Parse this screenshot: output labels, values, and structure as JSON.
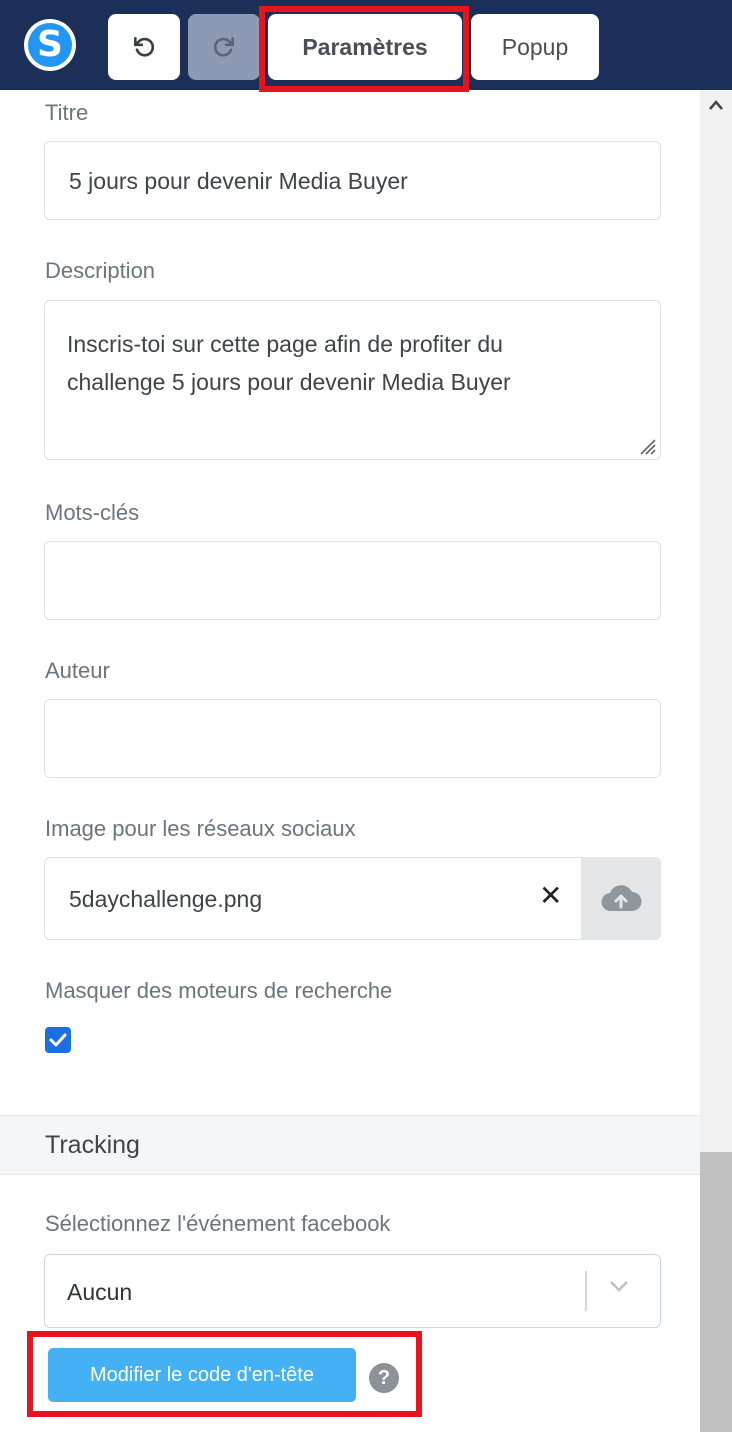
{
  "toolbar": {
    "logo_letter": "S",
    "undo_icon": "undo-icon",
    "redo_icon": "redo-icon",
    "tabs": [
      {
        "label": "Paramètres",
        "active": true
      },
      {
        "label": "Popup",
        "active": false
      }
    ],
    "bg_color": "#1b2f58",
    "logo_color": "#2196f3"
  },
  "form": {
    "title_label": "Titre",
    "title_value": "5 jours pour devenir Media Buyer",
    "description_label": "Description",
    "description_value": "Inscris-toi sur cette page afin de profiter du\nchallenge 5 jours pour devenir Media Buyer",
    "keywords_label": "Mots-clés",
    "keywords_value": "",
    "author_label": "Auteur",
    "author_value": "",
    "social_image_label": "Image pour les réseaux sociaux",
    "social_image_value": "5daychallenge.png",
    "clear_icon": "close-icon",
    "upload_icon": "cloud-upload-icon",
    "hide_search_label": "Masquer des moteurs de recherche",
    "hide_search_checked": true
  },
  "tracking": {
    "section_title": "Tracking",
    "fb_event_label": "Sélectionnez l'événement facebook",
    "fb_event_value": "Aucun",
    "header_code_button": "Modifier le code d'en-tête",
    "help_icon_text": "?",
    "button_color": "#45b1f5",
    "checkbox_color": "#1c6fe0"
  },
  "highlight_color": "#e8141d"
}
